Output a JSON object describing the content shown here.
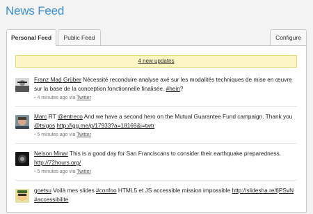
{
  "page": {
    "title": "News Feed"
  },
  "tabs": {
    "personal": "Personal Feed",
    "public": "Public Feed",
    "configure": "Configure"
  },
  "banner": {
    "text": "4 new updates"
  },
  "feed": [
    {
      "author": "Franz Mad Grüber",
      "text1": " Nécessité reconduire analyse axé sur les modalités techniques de mise en œuvre sur la base de la conception fonctionnelle finalisée. ",
      "tag": "#hein",
      "text2": "?",
      "time": "4 minutes ago",
      "via": "via",
      "source": "Twitter"
    },
    {
      "author": "Marc",
      "pre": " RT ",
      "mention": "@entreco",
      "text1": " And we have a second hero on the Mutual Guarantee Fund campaign. Thank you ",
      "mention2": "@tsigos",
      "space": " ",
      "link": "http://igg.me/p/17933?a=18169&i=twtr",
      "time": "5 minutes ago",
      "via": "via",
      "source": "Twitter"
    },
    {
      "author": "Nelson Minar",
      "text1": " This is a good day for San Franciscans to consider their earthquake preparedness. ",
      "link": "http://72hours.org/",
      "time": "5 minutes ago",
      "via": "via",
      "source": "Twitter"
    },
    {
      "author": "goetsu",
      "text1": " Voilà mes slides ",
      "tag": "#confoo",
      "text2": " HTML5 et JS accessible mission impossible ",
      "link": "http://slidesha.re/fjPSvN",
      "space": " ",
      "tag2": "#accessibilite"
    }
  ],
  "colors": {
    "title": "#3d8fd1",
    "banner_bg": "#fbf6c3",
    "banner_border": "#e6db79"
  }
}
